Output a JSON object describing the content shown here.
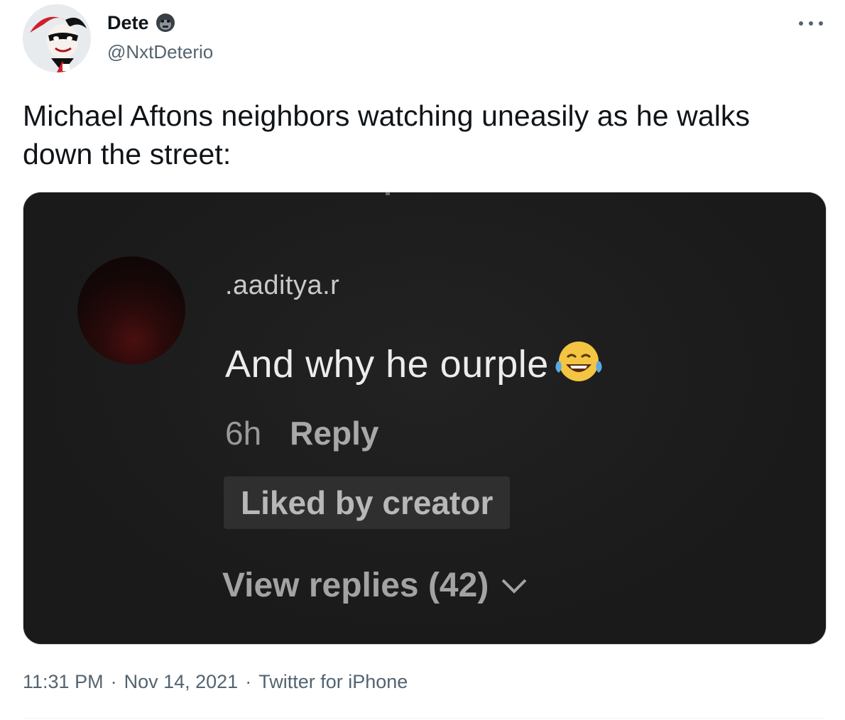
{
  "author": {
    "display_name": "Dete",
    "handle": "@NxtDeterio",
    "badge_icon": "gorilla-emoji-icon",
    "avatar_icon": "harley-quinn-avatar-icon"
  },
  "more_icon": "more-dots-icon",
  "tweet": {
    "text": "Michael Aftons neighbors watching uneasily as he walks down the street:"
  },
  "media": {
    "background": "#1c1c1c",
    "comment": {
      "username": ".aaditya.r",
      "text": "And why he ourple",
      "emoji": "tears-of-joy-emoji-icon",
      "age": "6h",
      "reply_label": "Reply",
      "liked_badge": "Liked by creator",
      "view_replies": "View replies (42)",
      "chevron": "chevron-down-icon"
    }
  },
  "footer": {
    "time": "11:31 PM",
    "separator": "·",
    "date": "Nov 14, 2021",
    "source": "Twitter for iPhone"
  }
}
